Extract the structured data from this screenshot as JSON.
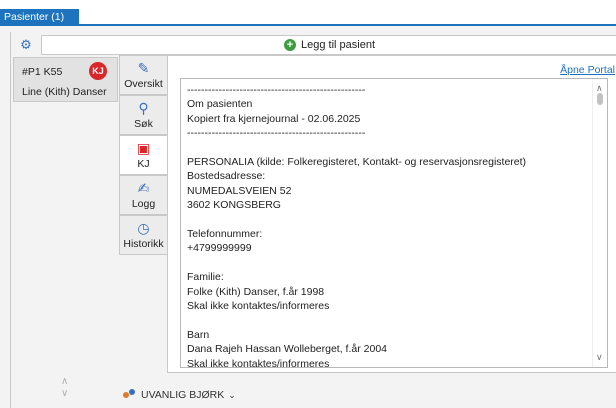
{
  "tab": {
    "label": "Pasienter (1)"
  },
  "toolbar": {
    "add_patient_label": "Legg til pasient"
  },
  "patient": {
    "id": "#P1 K55",
    "name": "Line (Kith) Danser",
    "badge": "KJ"
  },
  "nav": {
    "items": [
      {
        "label": "Oversikt",
        "icon": "pencil-icon"
      },
      {
        "label": "Søk",
        "icon": "search-icon"
      },
      {
        "label": "KJ",
        "icon": "kj-doc-icon"
      },
      {
        "label": "Logg",
        "icon": "edit-log-icon"
      },
      {
        "label": "Historikk",
        "icon": "history-icon"
      }
    ]
  },
  "panel": {
    "portal_link": "Åpne Portal",
    "lines": [
      "---------------------------------------------------",
      "Om pasienten",
      "Kopiert fra kjernejournal - 02.06.2025",
      "---------------------------------------------------",
      "",
      "PERSONALIA (kilde: Folkeregisteret, Kontakt- og reservasjonsregisteret)",
      "Bostedsadresse:",
      "NUMEDALSVEIEN 52",
      "3602 KONGSBERG",
      "",
      "Telefonnummer:",
      "+4799999999",
      "",
      "Familie:",
      "Folke (Kith) Danser, f.år 1998",
      "Skal ikke kontaktes/informeres",
      "",
      "Barn",
      "Dana Rajeh Hassan Wolleberget, f.år 2004",
      "Skal ikke kontaktes/informeres"
    ]
  },
  "status": {
    "label": "UVANLIG BJØRK"
  },
  "colors": {
    "accent": "#1e73be",
    "kj_badge": "#d9262b",
    "add": "#3e9b3e"
  }
}
